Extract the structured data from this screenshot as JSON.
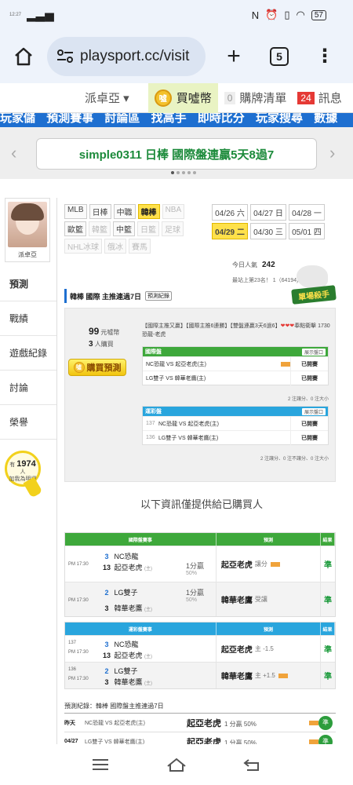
{
  "status": {
    "time": "12:27",
    "battery": "57"
  },
  "browser": {
    "url": "playsport.cc/visit",
    "tab_count": "5"
  },
  "sitenav": {
    "lang": "派卓亞 ▾",
    "coin_label": "買噓幣",
    "coin_icon_text": "噓",
    "cart_count": "0",
    "cart_label": "購牌清單",
    "msg_count": "24",
    "msg_label": "訊息"
  },
  "menu_strip": [
    "玩家儲",
    "預測賽事",
    "討論區",
    "找高手",
    "即時比分",
    "玩家搜尋",
    "數據"
  ],
  "banner": {
    "text": "simple0311 日棒 國際盤連贏5天8過7",
    "left_arrow": "‹",
    "right_arrow": "›"
  },
  "profile": {
    "name": "派卓亞"
  },
  "sidenav": [
    {
      "label": "預測"
    },
    {
      "label": "戰績"
    },
    {
      "label": "遊戲紀錄"
    },
    {
      "label": "討論"
    },
    {
      "label": "榮譽"
    }
  ],
  "likes": {
    "prefix": "有",
    "count": "1974",
    "unit": "人",
    "suffix": "加我為明燈"
  },
  "tags": [
    {
      "label": "MLB",
      "state": "normal"
    },
    {
      "label": "日棒",
      "state": "normal"
    },
    {
      "label": "中職",
      "state": "normal"
    },
    {
      "label": "韓棒",
      "state": "on"
    },
    {
      "label": "NBA",
      "state": "dim"
    },
    {
      "label": "歐籃",
      "state": "normal"
    },
    {
      "label": "韓籃",
      "state": "dim"
    },
    {
      "label": "中籃",
      "state": "normal"
    },
    {
      "label": "日籃",
      "state": "dim"
    },
    {
      "label": "足球",
      "state": "dim"
    },
    {
      "label": "NHL冰球",
      "state": "dim"
    },
    {
      "label": "俄冰",
      "state": "dim"
    },
    {
      "label": "賽馬",
      "state": "dim"
    }
  ],
  "dates": [
    {
      "label": "04/26 六",
      "state": "normal"
    },
    {
      "label": "04/27 日",
      "state": "normal"
    },
    {
      "label": "04/28 一",
      "state": "normal"
    },
    {
      "label": "04/29 二",
      "state": "on"
    },
    {
      "label": "04/30 三",
      "state": "normal"
    },
    {
      "label": "05/01 四",
      "state": "normal"
    }
  ],
  "popularity": {
    "label": "今日人氣",
    "value": "242",
    "rank": "最站上第23名！ 1（64194)"
  },
  "splash_label": "單場殺手",
  "rec": {
    "title": "韓棒 國際 主推連過7日",
    "record_btn": "預測紀錄",
    "price_value": "99",
    "price_unit": "元噓幣",
    "bought_count": "3",
    "bought_label": "人購買",
    "buy_label": "購買預測",
    "desc": "【國際主推又贏】【國際主推6連勝】【雙盤連贏3天6過6】",
    "hearts": "❤❤❤",
    "desc_tail": "奉點衛擊 1730 恐龍-老虎"
  },
  "mini_intl": {
    "title": "國際盤",
    "open_label": "展示盤口",
    "rows": [
      {
        "game": "NC恐龍 VS 起亞老虎(主)",
        "pick": "已開賽"
      },
      {
        "game": "LG雙子 VS 韓華老鷹(主)",
        "pick": "已開賽"
      }
    ],
    "footer": "2 注讓分、0 注大小"
  },
  "mini_color": {
    "title": "運彩盤",
    "open_label": "展示盤口",
    "rows": [
      {
        "num": "137",
        "game": "NC恐龍 VS 起亞老虎(主)",
        "pick": "已開賽"
      },
      {
        "num": "136",
        "game": "LG雙子 VS 韓華老鷹(主)",
        "pick": "已開賽"
      }
    ],
    "footer": "2 注讓分、0 注不讓分、0 注大小"
  },
  "notice": "以下資訊僅提供給已購買人",
  "intl_table": {
    "headers": [
      "國際盤賽事",
      "預測",
      "結果"
    ],
    "rows": [
      {
        "time": "PM 17:30",
        "t1_num": "3",
        "t1": "NC恐龍",
        "t2_num": "13",
        "t2": "起亞老虎",
        "t2_tag": "(主)",
        "spread": "1分贏",
        "spread_pct": "50%",
        "pick": "起亞老虎",
        "pick_note": "讓分",
        "result": "準"
      },
      {
        "time": "PM 17:30",
        "t1_num": "2",
        "t1": "LG雙子",
        "t2_num": "3",
        "t2": "韓華老鷹",
        "t2_tag": "(主)",
        "spread": "1分贏",
        "spread_pct": "50%",
        "pick": "韓華老鷹",
        "pick_note": "受讓",
        "result": "準"
      }
    ]
  },
  "color_table": {
    "headers": [
      "運彩盤賽事",
      "預測",
      "結果"
    ],
    "rows": [
      {
        "num": "137",
        "time": "PM 17:30",
        "t1_num": "3",
        "t1": "NC恐龍",
        "t2_num": "13",
        "t2": "起亞老虎",
        "t2_tag": "(主)",
        "pick": "起亞老虎",
        "pick_note": "主 -1.5",
        "result": "準"
      },
      {
        "num": "136",
        "time": "PM 17:30",
        "t1_num": "2",
        "t1": "LG雙子",
        "t2_num": "3",
        "t2": "韓華老鷹",
        "t2_tag": "(主)",
        "pick": "韓華老鷹",
        "pick_note": "主 +1.5",
        "result": "準"
      }
    ]
  },
  "log": {
    "heading": "預測紀錄：韓棒 國際盤主推連過7日",
    "rows": [
      {
        "day": "昨天",
        "game": "NC恐龍 VS 起亞老虎(主)",
        "pick": "起亞老虎",
        "note": "1 分贏 50%",
        "badge": "準"
      },
      {
        "day": "04/27",
        "game": "LG雙子 VS 韓華老鷹(主)",
        "pick": "起亞老虎",
        "note": "1 分贏 50%",
        "badge": "準"
      }
    ]
  },
  "colors": {
    "accent_blue": "#1e6fd0",
    "green_head": "#3ea83b",
    "cyan_head": "#29a5dd",
    "highlight": "#ffe14a"
  }
}
